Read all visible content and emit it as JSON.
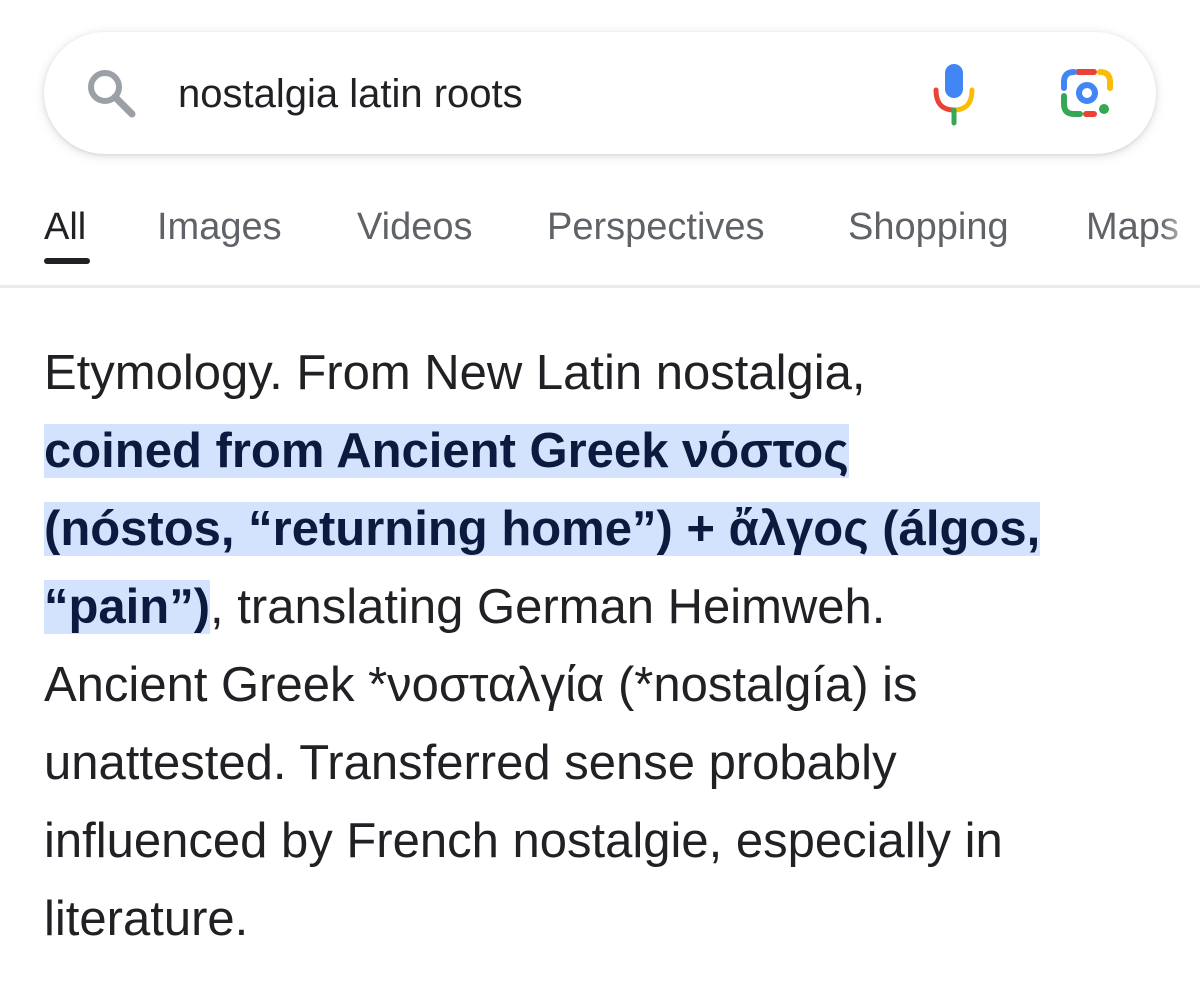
{
  "search": {
    "query": "nostalgia latin roots"
  },
  "tabs": [
    {
      "label": "All",
      "active": true
    },
    {
      "label": "Images",
      "active": false
    },
    {
      "label": "Videos",
      "active": false
    },
    {
      "label": "Perspectives",
      "active": false
    },
    {
      "label": "Shopping",
      "active": false
    },
    {
      "label": "Maps",
      "active": false
    }
  ],
  "snippet": {
    "line1": "Etymology. From New Latin nostalgia,",
    "line2_highlight": "coined from Ancient Greek νόστος",
    "line3_highlight": "(nóstos, “returning home”) + ἄλγος (álgos,",
    "line4_highlight": "“pain”)",
    "line4_rest": ", translating German Heimweh.",
    "line5": "Ancient Greek *νοσταλγία (*nostalgía) is",
    "line6": "unattested. Transferred sense probably",
    "line7": "influenced by French nostalgie, especially in",
    "line8": "literature."
  },
  "colors": {
    "highlight": "#d3e3fd",
    "highlight_text": "#0b1b3f",
    "google_blue": "#4285f4",
    "google_red": "#ea4335",
    "google_yellow": "#fbbc05",
    "google_green": "#34a853"
  },
  "icons": {
    "search": "search-icon",
    "mic": "mic-icon",
    "lens": "lens-icon"
  }
}
